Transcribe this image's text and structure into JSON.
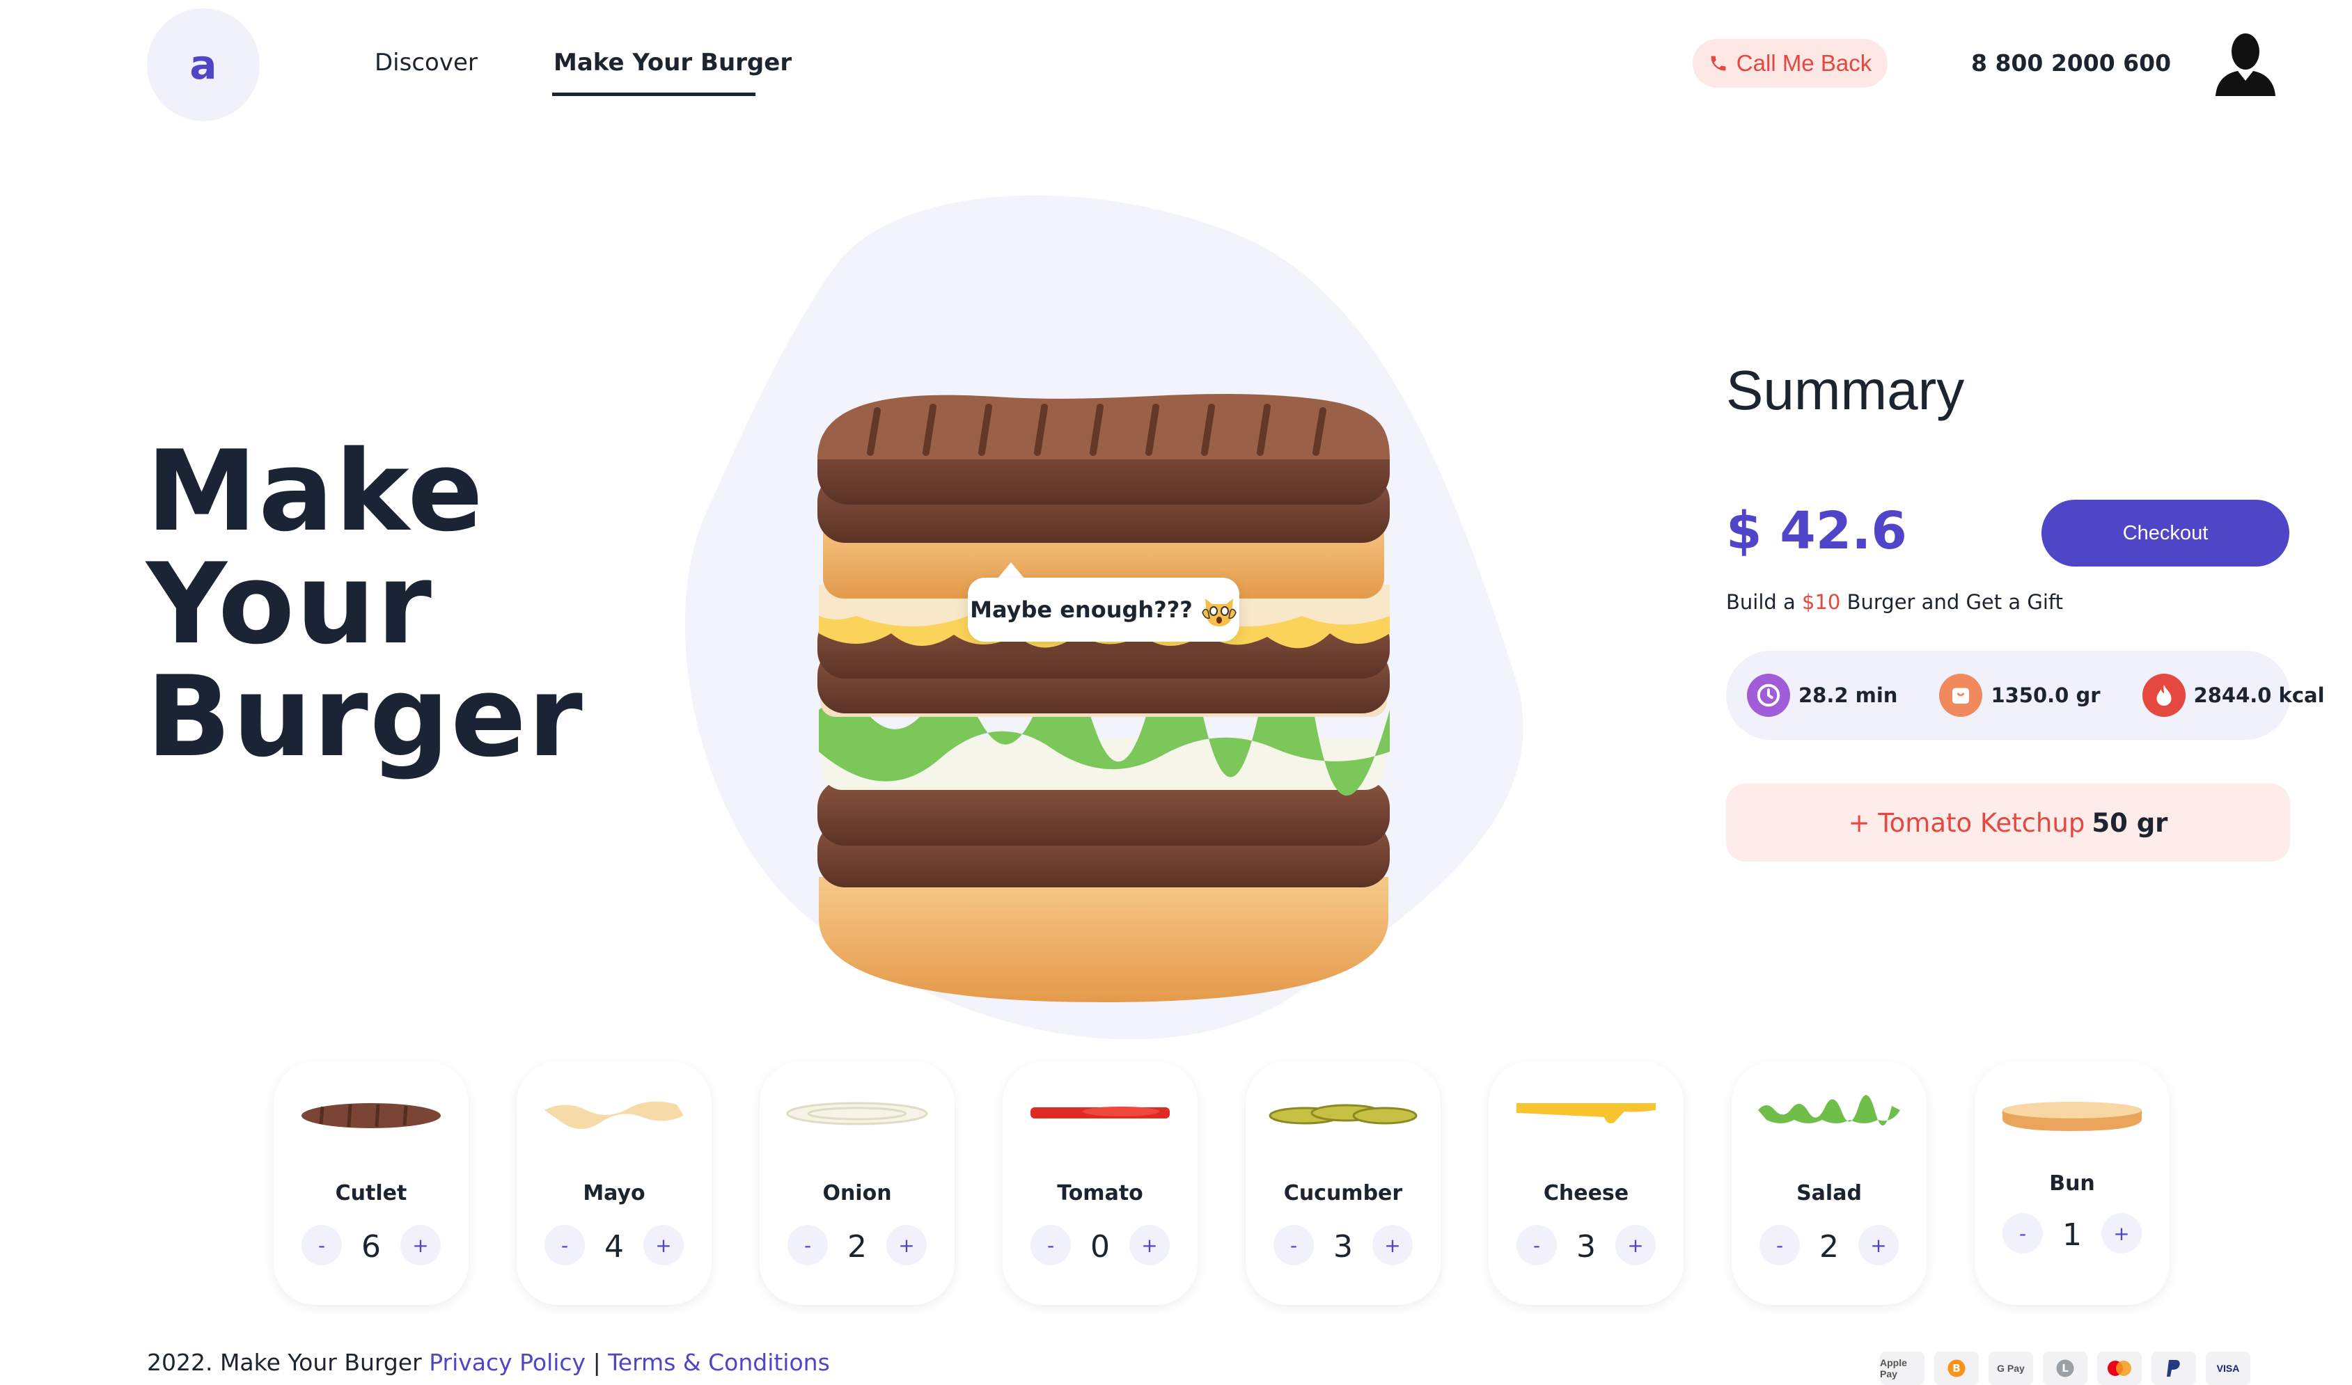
{
  "header": {
    "logo_letter": "a",
    "nav": [
      {
        "label": "Discover",
        "active": false
      },
      {
        "label": "Make Your Burger",
        "active": true
      }
    ],
    "call_back_label": "Call Me Back",
    "phone": "8 800 2000 600",
    "icons": {
      "phone": "phone-icon",
      "user": "user-avatar-icon"
    }
  },
  "hero": {
    "title_lines": [
      "Make",
      "Your",
      "Burger"
    ],
    "bubble_text": "Maybe enough???",
    "bubble_icon": "screaming-cat-emoji-icon"
  },
  "summary": {
    "title": "Summary",
    "price": "$ 42.6",
    "checkout_label": "Checkout",
    "gift_prefix": "Build a",
    "gift_amount": "$10",
    "gift_suffix": "Burger and Get a Gift",
    "stats": [
      {
        "icon": "clock-icon",
        "value": "28.2 min",
        "color": "#a15cd8"
      },
      {
        "icon": "weight-icon",
        "value": "1350.0 gr",
        "color": "#f08a5d"
      },
      {
        "icon": "fire-icon",
        "value": "2844.0 kcal",
        "color": "#e5483f"
      }
    ],
    "addon": {
      "name": "+ Tomato Ketchup",
      "amount": "50 gr"
    }
  },
  "ingredients": [
    {
      "name": "Cutlet",
      "qty": "6",
      "icon": "cutlet-icon"
    },
    {
      "name": "Mayo",
      "qty": "4",
      "icon": "mayo-icon"
    },
    {
      "name": "Onion",
      "qty": "2",
      "icon": "onion-icon"
    },
    {
      "name": "Tomato",
      "qty": "0",
      "icon": "tomato-icon"
    },
    {
      "name": "Cucumber",
      "qty": "3",
      "icon": "cucumber-icon"
    },
    {
      "name": "Cheese",
      "qty": "3",
      "icon": "cheese-icon"
    },
    {
      "name": "Salad",
      "qty": "2",
      "icon": "salad-icon"
    },
    {
      "name": "Bun",
      "qty": "1",
      "icon": "bun-icon"
    }
  ],
  "controls": {
    "minus": "-",
    "plus": "+"
  },
  "footer": {
    "copyright": "2022. Make Your Burger",
    "privacy": "Privacy Policy",
    "separator": "|",
    "terms": "Terms & Conditions",
    "payments": [
      "Apple Pay",
      "Bitcoin",
      "G Pay",
      "Litecoin",
      "Mastercard",
      "PayPal",
      "VISA"
    ]
  },
  "colors": {
    "accent": "#4f45c7",
    "red": "#e5483f",
    "soft_bg": "#f1f1fb"
  }
}
